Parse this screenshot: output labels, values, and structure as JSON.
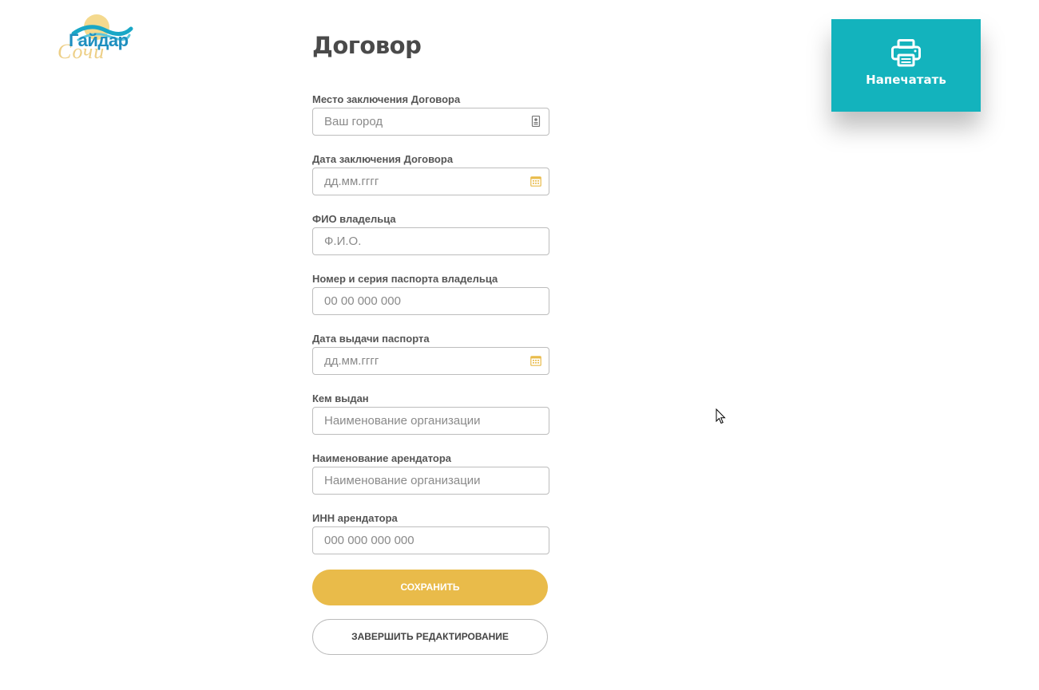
{
  "logo": {
    "name": "Гайдар",
    "sub": "Сочи"
  },
  "page": {
    "title": "Договор"
  },
  "form": {
    "fields": [
      {
        "label": "Место заключения Договора",
        "placeholder": "Ваш город",
        "icon": "contact-card-icon"
      },
      {
        "label": "Дата заключения Договора",
        "placeholder": "дд.мм.гггг",
        "icon": "calendar-icon"
      },
      {
        "label": "ФИО владельца",
        "placeholder": "Ф.И.О."
      },
      {
        "label": "Номер и серия паспорта владельца",
        "placeholder": "00 00 000 000"
      },
      {
        "label": "Дата выдачи паспорта",
        "placeholder": "дд.мм.гггг",
        "icon": "calendar-icon"
      },
      {
        "label": "Кем выдан",
        "placeholder": "Наименование организации"
      },
      {
        "label": "Наименование арендатора",
        "placeholder": "Наименование организации"
      },
      {
        "label": "ИНН арендатора",
        "placeholder": "000 000 000 000"
      }
    ]
  },
  "buttons": {
    "save": "СОХРАНИТЬ",
    "finish": "ЗАВЕРШИТЬ РЕДАКТИРОВАНИЕ",
    "print": "Напечатать"
  },
  "colors": {
    "accent_yellow": "#e9bb4a",
    "print_teal": "#13b3bd",
    "logo_blue": "#1e8fbf",
    "logo_gold": "#e9c46a",
    "calendar_icon": "#e9bb4a"
  }
}
